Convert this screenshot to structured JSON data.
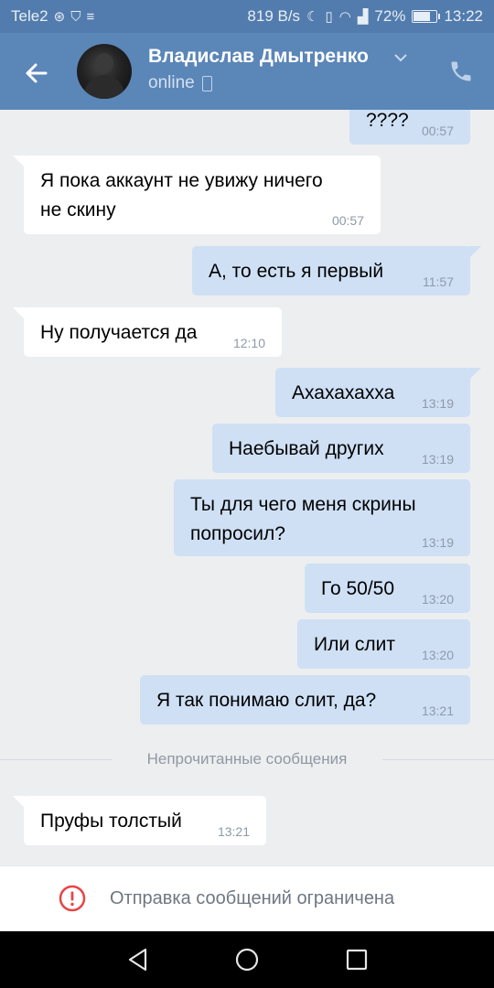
{
  "status_bar": {
    "carrier": "Tele2",
    "network_speed": "819 B/s",
    "battery": "72%",
    "battery_level": 0.72,
    "time": "13:22"
  },
  "header": {
    "contact_name": "Владислав Дмытренко",
    "status": "online"
  },
  "messages": [
    {
      "dir": "out",
      "text": "????",
      "time": "00:57"
    },
    {
      "dir": "in",
      "text": "Я пока аккаунт не увижу ничего",
      "text2": "не скину",
      "time": "00:57"
    },
    {
      "dir": "out",
      "text": "А, то есть я первый",
      "time": "11:57"
    },
    {
      "dir": "in",
      "text": "Ну получается да",
      "time": "12:10"
    },
    {
      "dir": "out",
      "text": "Ахахахахха",
      "time": "13:19"
    },
    {
      "dir": "out",
      "text": "Наебывай других",
      "time": "13:19"
    },
    {
      "dir": "out",
      "text": "Ты для чего меня скрины",
      "text2": "попросил?",
      "time": "13:19"
    },
    {
      "dir": "out",
      "text": "Го 50/50",
      "time": "13:20"
    },
    {
      "dir": "out",
      "text": "Или слит",
      "time": "13:20"
    },
    {
      "dir": "out",
      "text": "Я так понимаю слит, да?",
      "time": "13:21"
    },
    {
      "dir": "in",
      "text": "Пруфы толстый",
      "time": "13:21"
    }
  ],
  "unread_divider": "Непрочитанные сообщения",
  "footer": {
    "restricted_text": "Отправка сообщений ограничена"
  },
  "colors": {
    "header_bg": "#5b86b8",
    "status_bar_bg": "#527cad",
    "incoming_bubble": "#ffffff",
    "outgoing_bubble": "#cfe0f5",
    "chat_bg": "#edeef0",
    "warning_red": "#e64646"
  }
}
